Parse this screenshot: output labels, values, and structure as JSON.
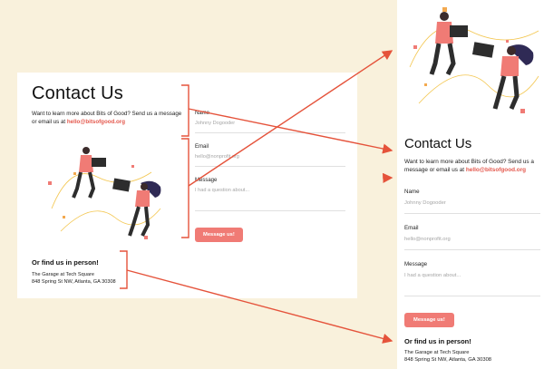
{
  "desktop": {
    "title": "Contact Us",
    "intro": "Want to learn more about Bits of Good? Send us a message or email us at",
    "email": "hello@bitsofgood.org",
    "form": {
      "name_label": "Name",
      "name_placeholder": "Johnny Dogooder",
      "email_label": "Email",
      "email_placeholder": "hello@nonprofit.org",
      "message_label": "Message",
      "message_placeholder": "I had a question about...",
      "submit_label": "Message us!"
    },
    "in_person": {
      "heading": "Or find us in person!",
      "address_line1": "The Garage at Tech Square",
      "address_line2": "848 Spring St NW, Atlanta, GA 30308"
    }
  },
  "mobile": {
    "title": "Contact Us",
    "intro": "Want to learn more about Bits of Good? Send us a message or email us at",
    "email": "hello@bitsofgood.org",
    "form": {
      "name_label": "Name",
      "name_placeholder": "Johnny Dogooder",
      "email_label": "Email",
      "email_placeholder": "hello@nonprofit.org",
      "message_label": "Message",
      "message_placeholder": "I had a question about...",
      "submit_label": "Message us!"
    },
    "in_person": {
      "heading": "Or find us in person!",
      "address_line1": "The Garage at Tech Square",
      "address_line2": "848 Spring St NW, Atlanta, GA 30308"
    }
  },
  "colors": {
    "background": "#f9f1dc",
    "accent": "#f07b75",
    "link": "#e4584d",
    "annotation": "#e5533b"
  },
  "icons": [
    "contact-illustration",
    "bracket-annotation",
    "arrow-annotation"
  ]
}
